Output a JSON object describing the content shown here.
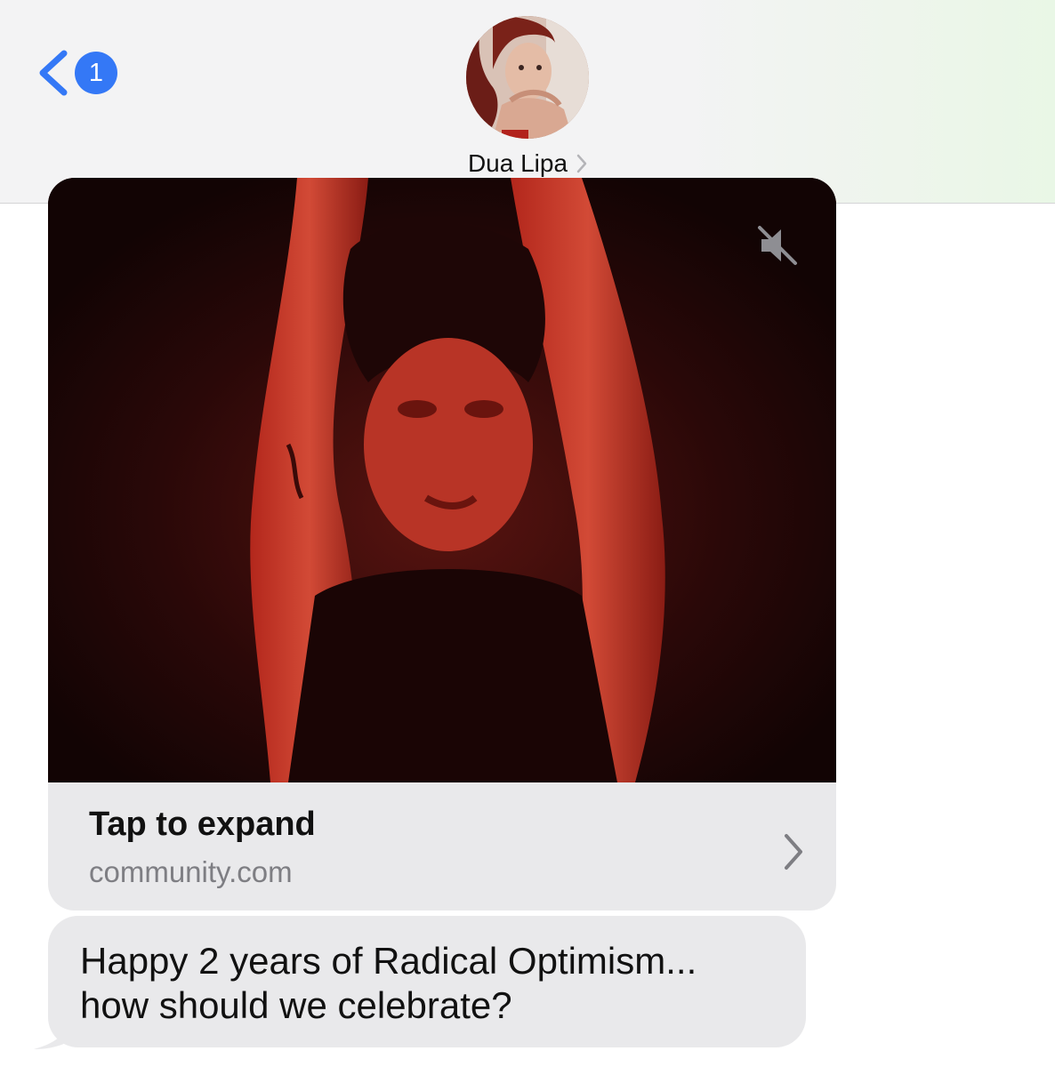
{
  "header": {
    "back_badge_count": "1",
    "contact_name": "Dua Lipa",
    "accent_color": "#3478f6"
  },
  "link_preview": {
    "title": "Tap to expand",
    "domain": "community.com",
    "media_icon": "speaker-muted-icon",
    "chevron_icon": "chevron-right-icon"
  },
  "message": {
    "text": "Happy 2 years of Radical Optimism...\nhow should we celebrate?"
  }
}
